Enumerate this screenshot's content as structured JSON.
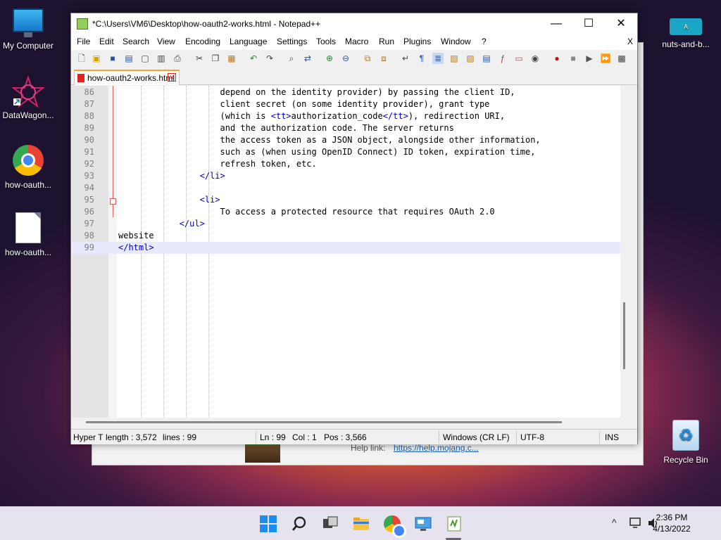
{
  "desktop": {
    "icons": [
      {
        "label": "My Computer"
      },
      {
        "label": "DataWagon..."
      },
      {
        "label": "how-oauth..."
      },
      {
        "label": "how-oauth..."
      },
      {
        "label": "nuts-and-b..."
      },
      {
        "label": "Recycle Bin"
      }
    ],
    "nuts_icon_text": "A"
  },
  "background_window": {
    "help_label": "Help link:",
    "help_link": "https://help.mojang.c..."
  },
  "window": {
    "title": "*C:\\Users\\VM6\\Desktop\\how-oauth2-works.html - Notepad++",
    "controls": {
      "minimize": "—",
      "maximize": "☐",
      "close": "✕"
    }
  },
  "menu": {
    "items": [
      "File",
      "Edit",
      "Search",
      "View",
      "Encoding",
      "Language",
      "Settings",
      "Tools",
      "Macro",
      "Run",
      "Plugins",
      "Window",
      "?"
    ],
    "close_doc": "X"
  },
  "toolbar": {
    "icons": [
      "new-icon",
      "open-icon",
      "save-icon",
      "save-all-icon",
      "close-icon",
      "close-all-icon",
      "print-icon",
      "cut-icon",
      "copy-icon",
      "paste-icon",
      "undo-icon",
      "redo-icon",
      "find-icon",
      "replace-icon",
      "zoom-in-icon",
      "zoom-out-icon",
      "sync-v-icon",
      "sync-h-icon",
      "wrap-icon",
      "all-chars-icon",
      "indent-guide-icon",
      "udl-icon",
      "doc-map-icon",
      "doc-list-icon",
      "function-list-icon",
      "folder-workspace-icon",
      "monitor-icon",
      "record-macro-icon",
      "stop-macro-icon",
      "play-macro-icon",
      "run-macro-multiple-icon",
      "save-macro-icon"
    ]
  },
  "tab": {
    "label": "how-oauth2-works.html",
    "close": "✕"
  },
  "editor": {
    "lines": [
      {
        "num": "86",
        "segments": [
          {
            "text": "                    depend on the identity provider) by passing the client ID,",
            "kind": "text"
          }
        ]
      },
      {
        "num": "87",
        "segments": [
          {
            "text": "                    client secret (on some identity provider), grant type",
            "kind": "text"
          }
        ]
      },
      {
        "num": "88",
        "segments": [
          {
            "text": "                    (which is ",
            "kind": "text"
          },
          {
            "text": "<tt>",
            "kind": "tag"
          },
          {
            "text": "authorization_code",
            "kind": "text"
          },
          {
            "text": "</tt>",
            "kind": "tag"
          },
          {
            "text": "), redirection URI,",
            "kind": "text"
          }
        ]
      },
      {
        "num": "89",
        "segments": [
          {
            "text": "                    and the authorization code. The server returns",
            "kind": "text"
          }
        ]
      },
      {
        "num": "90",
        "segments": [
          {
            "text": "                    the access token as a JSON object, alongside other information,",
            "kind": "text"
          }
        ]
      },
      {
        "num": "91",
        "segments": [
          {
            "text": "                    such as (when using OpenID Connect) ID token, expiration time,",
            "kind": "text"
          }
        ]
      },
      {
        "num": "92",
        "segments": [
          {
            "text": "                    refresh token, etc.",
            "kind": "text"
          }
        ]
      },
      {
        "num": "93",
        "segments": [
          {
            "text": "                ",
            "kind": "text"
          },
          {
            "text": "</li>",
            "kind": "tag"
          }
        ]
      },
      {
        "num": "94",
        "segments": [
          {
            "text": "",
            "kind": "text"
          }
        ]
      },
      {
        "num": "95",
        "segments": [
          {
            "text": "                ",
            "kind": "text"
          },
          {
            "text": "<li>",
            "kind": "tag"
          }
        ]
      },
      {
        "num": "96",
        "segments": [
          {
            "text": "                    To access a protected resource that requires OAuth 2.0",
            "kind": "text"
          }
        ]
      },
      {
        "num": "97",
        "segments": [
          {
            "text": "            ",
            "kind": "text"
          },
          {
            "text": "</ul>",
            "kind": "tag"
          }
        ]
      },
      {
        "num": "98",
        "segments": [
          {
            "text": "website",
            "kind": "text"
          }
        ]
      },
      {
        "num": "99",
        "segments": [
          {
            "text": "</html>",
            "kind": "tag"
          }
        ]
      }
    ],
    "current_line": "99"
  },
  "statusbar": {
    "type": "Hyper T",
    "length": "length : 3,572",
    "lines": "lines : 99",
    "ln": "Ln : 99",
    "col": "Col : 1",
    "pos": "Pos : 3,566",
    "eol": "Windows (CR LF)",
    "encoding": "UTF-8",
    "mode": "INS"
  },
  "taskbar": {
    "time": "2:36 PM",
    "date": "4/13/2022",
    "tray_chevron": "^"
  },
  "colors": {
    "tag": "#0000c0",
    "tab_accent": "#f7a32d",
    "taskbar": "#e6e3ee"
  }
}
